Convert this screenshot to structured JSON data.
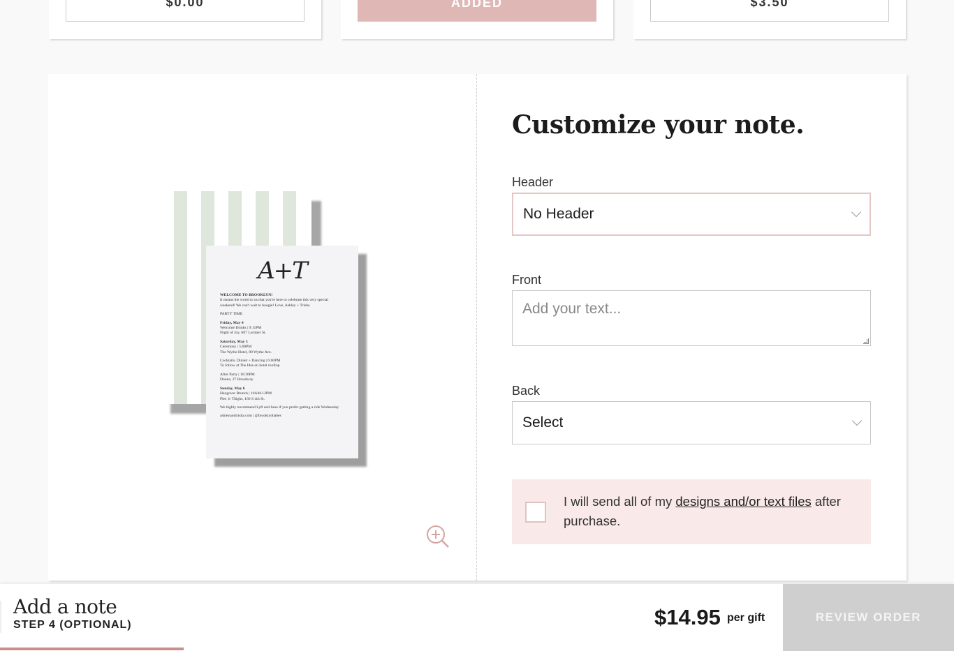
{
  "top_cards": [
    {
      "price": "$0.00"
    },
    {
      "button_label": "ADDED",
      "button_color": "#dfb8b6"
    },
    {
      "price": "$3.50"
    }
  ],
  "preview": {
    "monogram": "A+T",
    "invitation_lines": [
      {
        "text": "WELCOME TO BROOKLYN!",
        "bold": true
      },
      {
        "text": "It means the world to us that you're here to celebrate this very special"
      },
      {
        "text": "weekend! We can't wait to boogie! Love, Ashley + Trisha"
      },
      {
        "text": "PARTY TIME",
        "gap": true
      },
      {
        "text": "Friday, May 4",
        "bold": true,
        "gap": true
      },
      {
        "text": "Welcome Drinks | 9:11PM"
      },
      {
        "text": "Night of Joy, 687 Lorimer St."
      },
      {
        "text": "Saturday, May 5",
        "bold": true,
        "gap": true
      },
      {
        "text": "Ceremony | 5:00PM"
      },
      {
        "text": "The Wythe Hotel, 80 Wythe Ave."
      },
      {
        "text": "Cocktails, Dinner + Dancing | 6:00PM",
        "gap": true
      },
      {
        "text": "To follow at The Ides on hotel rooftop"
      },
      {
        "text": "After Party | 10:30PM",
        "gap": true
      },
      {
        "text": "Donna, 27 Broadway"
      },
      {
        "text": "Sunday, May 6",
        "bold": true,
        "gap": true
      },
      {
        "text": "Hangover Brunch | 10AM-12PM"
      },
      {
        "text": "Pies 'n' Thighs, 166 S 4th St."
      },
      {
        "text": "We highly recommend Lyft and Juno if you prefer getting a ride Wednesday",
        "gap": true
      },
      {
        "text": "ashleyandtrisha.com | @brooklynbabes",
        "gap": true
      }
    ],
    "stripe_color": "#dfe6dc"
  },
  "form": {
    "title": "Customize your note.",
    "header_label": "Header",
    "header_value": "No Header",
    "front_label": "Front",
    "front_placeholder": "Add your text...",
    "back_label": "Back",
    "back_value": "Select",
    "notice_text_before": "I will send all of my ",
    "notice_link": "designs and/or text files",
    "notice_text_after": " after purchase.",
    "notice_bg": "#f9e9e8"
  },
  "footer": {
    "step_title": "Add a note",
    "step_sub": "STEP 4 (OPTIONAL)",
    "progress_fraction": 0.2346,
    "price": "$14.95",
    "per_gift": "per gift",
    "review_button": "REVIEW ORDER",
    "accent_color": "#c98f8f"
  }
}
